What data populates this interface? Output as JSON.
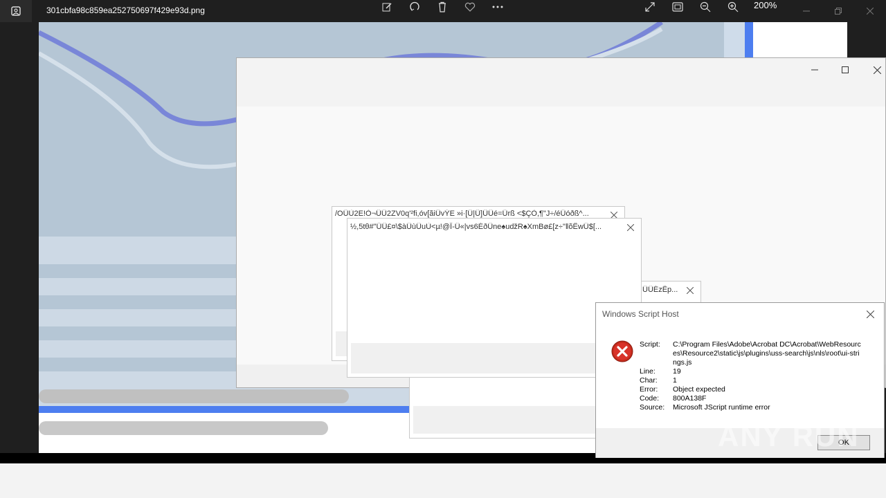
{
  "viewer": {
    "filename": "301cbfa98c859ea252750697f429e93d.png",
    "zoom": "200%",
    "icons": [
      "edit-icon",
      "rotate-icon",
      "delete-icon",
      "favorite-icon",
      "more-icon",
      "fullscreen-icon",
      "fit-icon",
      "zoom-out-icon",
      "zoom-in-icon"
    ]
  },
  "dialogs": {
    "garbled1_title": "/OÛÙ2E!Ò¬ÛÛ2ZV0q'²fi,óv[ãiÛvÝE »i·[Û|Û]ÛÛé=Ûrß <$ÇÒ,¶\"J÷/éÛóðß^...",
    "garbled2_title": "½,5tθ#\"ÜÛ£¤\\$àÛùÛuÙ<µ!@Î-Û«|vs6ÉðÛne♠uǆR♠XmBø£[z÷\"ǁõÊwÛ$[...",
    "garbled3_title": "ÛÛÉzÊp..."
  },
  "wsh": {
    "title": "Windows Script Host",
    "script_label": "Script:",
    "script_value": "C:\\Program Files\\Adobe\\Acrobat DC\\Acrobat\\WebResources\\Resource2\\static\\js\\plugins\\uss-search\\js\\nls\\root\\ui-strings.js",
    "line_label": "Line:",
    "line_value": "19",
    "char_label": "Char:",
    "char_value": "1",
    "error_label": "Error:",
    "error_value": "Object expected",
    "code_label": "Code:",
    "code_value": "800A138F",
    "source_label": "Source:",
    "source_value": "Microsoft JScript runtime error",
    "ok_label": "OK"
  },
  "watermark": "ANY RUN"
}
